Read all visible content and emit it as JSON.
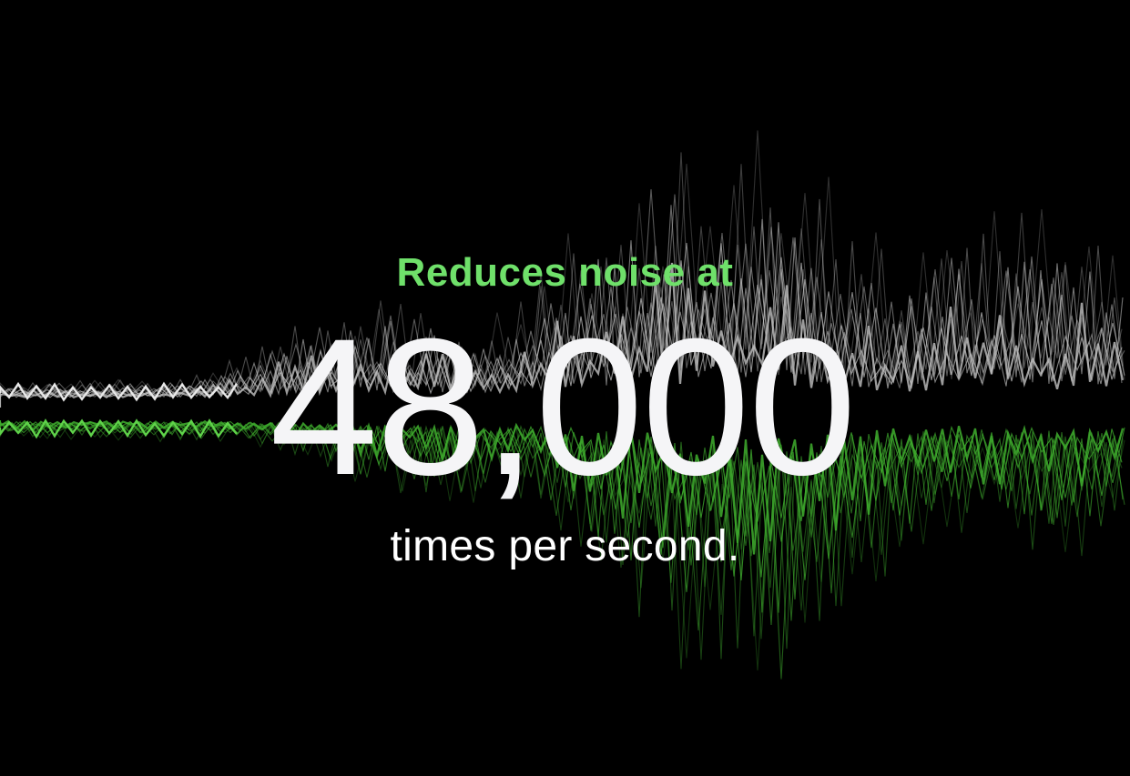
{
  "colors": {
    "background": "#000000",
    "accent_green": "#6fe06a",
    "number_white": "#f5f5f7",
    "caption_white": "#ffffff",
    "wave_upper": "#bfbfbf",
    "wave_lower": "#3fae2e"
  },
  "hero": {
    "eyebrow": "Reduces noise at",
    "number": "48,000",
    "caption": "times per second."
  }
}
